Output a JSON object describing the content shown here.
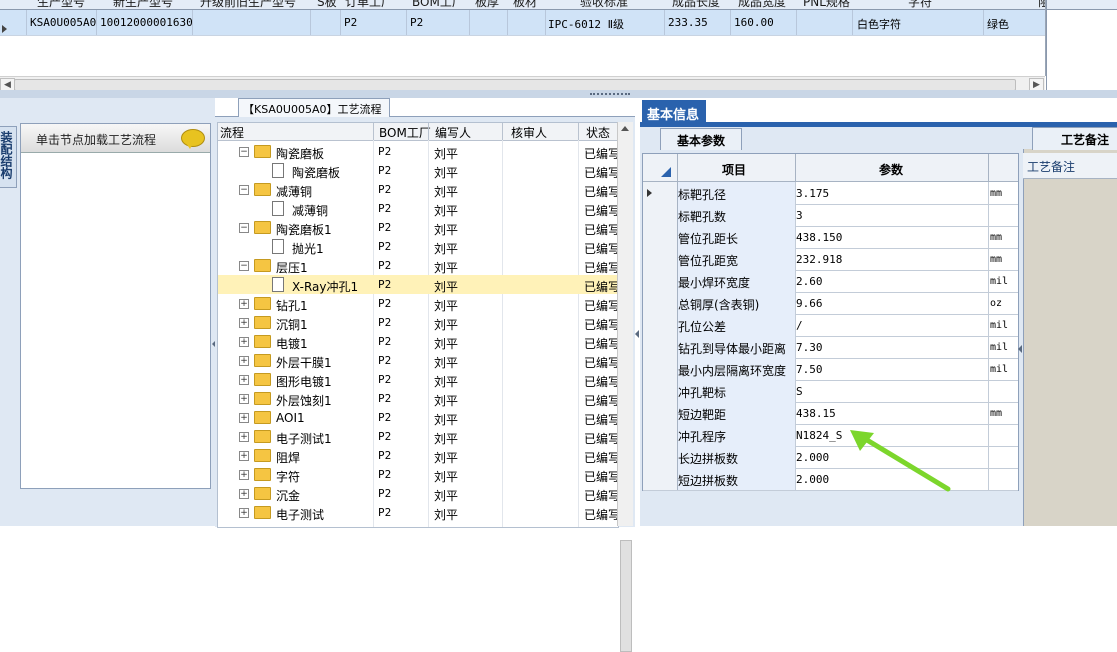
{
  "top_grid": {
    "headers": [
      "生产型号",
      "新生产型号",
      "升级前旧生产型号",
      "S板",
      "订单工厂",
      "BOM工厂",
      "板厚",
      "板材",
      "验收标准",
      "成品长度",
      "成品宽度",
      "PNL规格",
      "字符",
      "阻"
    ],
    "row": {
      "model": "KSA0U005A0",
      "new_model": "10012000001630",
      "order_factory": "P2",
      "bom_factory": "P2",
      "standard": "IPC-6012 Ⅱ级",
      "length": "233.35",
      "width": "160.00",
      "char": "白色字符",
      "solder": "绿色"
    },
    "right_header": "工艺备注"
  },
  "left_panel": {
    "vertical_tab": "装配结构",
    "header_text": "单击节点加载工艺流程"
  },
  "flow": {
    "title": "【KSA0U005A0】工艺流程",
    "columns": [
      "流程",
      "BOM工厂",
      "编写人",
      "核审人",
      "状态"
    ],
    "rows": [
      {
        "label": "陶瓷磨板",
        "type": "folder",
        "level": 1,
        "bom": "P2",
        "author": "刘平",
        "reviewer": "",
        "status": "已编写"
      },
      {
        "label": "陶瓷磨板",
        "type": "doc",
        "level": 2,
        "bom": "P2",
        "author": "刘平",
        "reviewer": "",
        "status": "已编写"
      },
      {
        "label": "减薄铜",
        "type": "folder",
        "level": 1,
        "bom": "P2",
        "author": "刘平",
        "reviewer": "",
        "status": "已编写"
      },
      {
        "label": "减薄铜",
        "type": "doc",
        "level": 2,
        "bom": "P2",
        "author": "刘平",
        "reviewer": "",
        "status": "已编写"
      },
      {
        "label": "陶瓷磨板1",
        "type": "folder",
        "level": 1,
        "bom": "P2",
        "author": "刘平",
        "reviewer": "",
        "status": "已编写"
      },
      {
        "label": "抛光1",
        "type": "doc",
        "level": 2,
        "bom": "P2",
        "author": "刘平",
        "reviewer": "",
        "status": "已编写"
      },
      {
        "label": "层压1",
        "type": "folder",
        "level": 1,
        "bom": "P2",
        "author": "刘平",
        "reviewer": "",
        "status": "已编写"
      },
      {
        "label": "X-Ray冲孔1",
        "type": "doc",
        "level": 2,
        "bom": "P2",
        "author": "刘平",
        "reviewer": "",
        "status": "已编写",
        "selected": true
      },
      {
        "label": "钻孔1",
        "type": "folder",
        "level": 1,
        "bom": "P2",
        "author": "刘平",
        "reviewer": "",
        "status": "已编写"
      },
      {
        "label": "沉铜1",
        "type": "folder",
        "level": 1,
        "bom": "P2",
        "author": "刘平",
        "reviewer": "",
        "status": "已编写"
      },
      {
        "label": "电镀1",
        "type": "folder",
        "level": 1,
        "bom": "P2",
        "author": "刘平",
        "reviewer": "",
        "status": "已编写"
      },
      {
        "label": "外层干膜1",
        "type": "folder",
        "level": 1,
        "bom": "P2",
        "author": "刘平",
        "reviewer": "",
        "status": "已编写"
      },
      {
        "label": "图形电镀1",
        "type": "folder",
        "level": 1,
        "bom": "P2",
        "author": "刘平",
        "reviewer": "",
        "status": "已编写"
      },
      {
        "label": "外层蚀刻1",
        "type": "folder",
        "level": 1,
        "bom": "P2",
        "author": "刘平",
        "reviewer": "",
        "status": "已编写"
      },
      {
        "label": "AOI1",
        "type": "folder",
        "level": 1,
        "bom": "P2",
        "author": "刘平",
        "reviewer": "",
        "status": "已编写"
      },
      {
        "label": "电子测试1",
        "type": "folder",
        "level": 1,
        "bom": "P2",
        "author": "刘平",
        "reviewer": "",
        "status": "已编写"
      },
      {
        "label": "阻焊",
        "type": "folder",
        "level": 1,
        "bom": "P2",
        "author": "刘平",
        "reviewer": "",
        "status": "已编写"
      },
      {
        "label": "字符",
        "type": "folder",
        "level": 1,
        "bom": "P2",
        "author": "刘平",
        "reviewer": "",
        "status": "已编写"
      },
      {
        "label": "沉金",
        "type": "folder",
        "level": 1,
        "bom": "P2",
        "author": "刘平",
        "reviewer": "",
        "status": "已编写"
      },
      {
        "label": "电子测试",
        "type": "folder",
        "level": 1,
        "bom": "P2",
        "author": "刘平",
        "reviewer": "",
        "status": "已编写"
      }
    ]
  },
  "info": {
    "tab": "基本信息",
    "subtab": "基本参数",
    "columns": [
      "项目",
      "参数"
    ],
    "params": [
      {
        "name": "标靶孔径",
        "value": "3.175",
        "unit": "mm",
        "current": true
      },
      {
        "name": "标靶孔数",
        "value": "3",
        "unit": ""
      },
      {
        "name": "管位孔距长",
        "value": "438.150",
        "unit": "mm"
      },
      {
        "name": "管位孔距宽",
        "value": "232.918",
        "unit": "mm"
      },
      {
        "name": "最小焊环宽度",
        "value": "2.60",
        "unit": "mil"
      },
      {
        "name": "总铜厚(含表铜)",
        "value": "9.66",
        "unit": "oz"
      },
      {
        "name": "孔位公差",
        "value": "/",
        "unit": "mil"
      },
      {
        "name": "钻孔到导体最小距离",
        "value": "7.30",
        "unit": "mil"
      },
      {
        "name": "最小内层隔离环宽度",
        "value": "7.50",
        "unit": "mil"
      },
      {
        "name": "冲孔靶标",
        "value": "S",
        "unit": ""
      },
      {
        "name": "短边靶距",
        "value": "438.15",
        "unit": "mm"
      },
      {
        "name": "冲孔程序",
        "value": "N1824_S",
        "unit": ""
      },
      {
        "name": "长边拼板数",
        "value": "2.000",
        "unit": ""
      },
      {
        "name": "短边拼板数",
        "value": "2.000",
        "unit": ""
      }
    ],
    "annotation_color": "#7cd62c"
  },
  "craft": {
    "tab": "工艺备注",
    "header": "工艺备注"
  }
}
